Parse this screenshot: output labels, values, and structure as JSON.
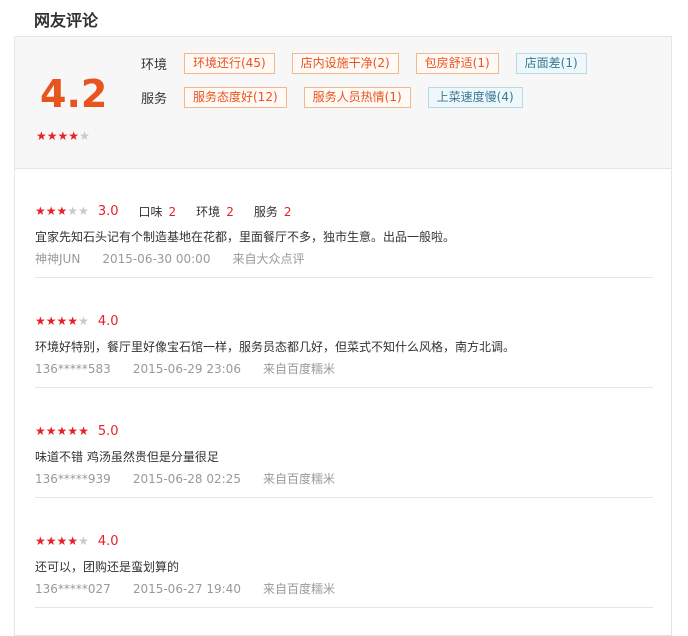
{
  "page": {
    "title": "网友评论"
  },
  "summary": {
    "score": "4.2",
    "stars_filled": 4,
    "stars_total": 5,
    "tag_groups": [
      {
        "category": "环境",
        "tags": [
          {
            "label": "环境还行(45)",
            "sentiment": "positive"
          },
          {
            "label": "店内设施干净(2)",
            "sentiment": "positive"
          },
          {
            "label": "包房舒适(1)",
            "sentiment": "positive"
          },
          {
            "label": "店面差(1)",
            "sentiment": "negative"
          }
        ]
      },
      {
        "category": "服务",
        "tags": [
          {
            "label": "服务态度好(12)",
            "sentiment": "positive"
          },
          {
            "label": "服务人员热情(1)",
            "sentiment": "positive"
          },
          {
            "label": "上菜速度慢(4)",
            "sentiment": "negative"
          }
        ]
      }
    ]
  },
  "reviews": [
    {
      "stars_filled": 3,
      "score": "3.0",
      "sub_scores": [
        {
          "label": "口味",
          "value": "2"
        },
        {
          "label": "环境",
          "value": "2"
        },
        {
          "label": "服务",
          "value": "2"
        }
      ],
      "text": "宜家先知石头记有个制造基地在花都，里面餐厅不多，独市生意。出品一般啦。",
      "user": "神神JUN",
      "time": "2015-06-30 00:00",
      "source": "来自大众点评"
    },
    {
      "stars_filled": 4,
      "score": "4.0",
      "sub_scores": [],
      "text": "环境好特别，餐厅里好像宝石馆一样，服务员态都几好，但菜式不知什么风格，南方北调。",
      "user": "136*****583",
      "time": "2015-06-29 23:06",
      "source": "来自百度糯米"
    },
    {
      "stars_filled": 5,
      "score": "5.0",
      "sub_scores": [],
      "text": "味道不错 鸡汤虽然贵但是分量很足",
      "user": "136*****939",
      "time": "2015-06-28 02:25",
      "source": "来自百度糯米"
    },
    {
      "stars_filled": 4,
      "score": "4.0",
      "sub_scores": [],
      "text": "还可以，团购还是蛮划算的",
      "user": "136*****027",
      "time": "2015-06-27 19:40",
      "source": "来自百度糯米"
    }
  ],
  "colors": {
    "score_orange": "#e8541e",
    "star_red": "#e6212a",
    "star_grey": "#c9c9c9",
    "positive_tag_border": "#f2b98f",
    "negative_tag_border": "#b7dbe6"
  }
}
